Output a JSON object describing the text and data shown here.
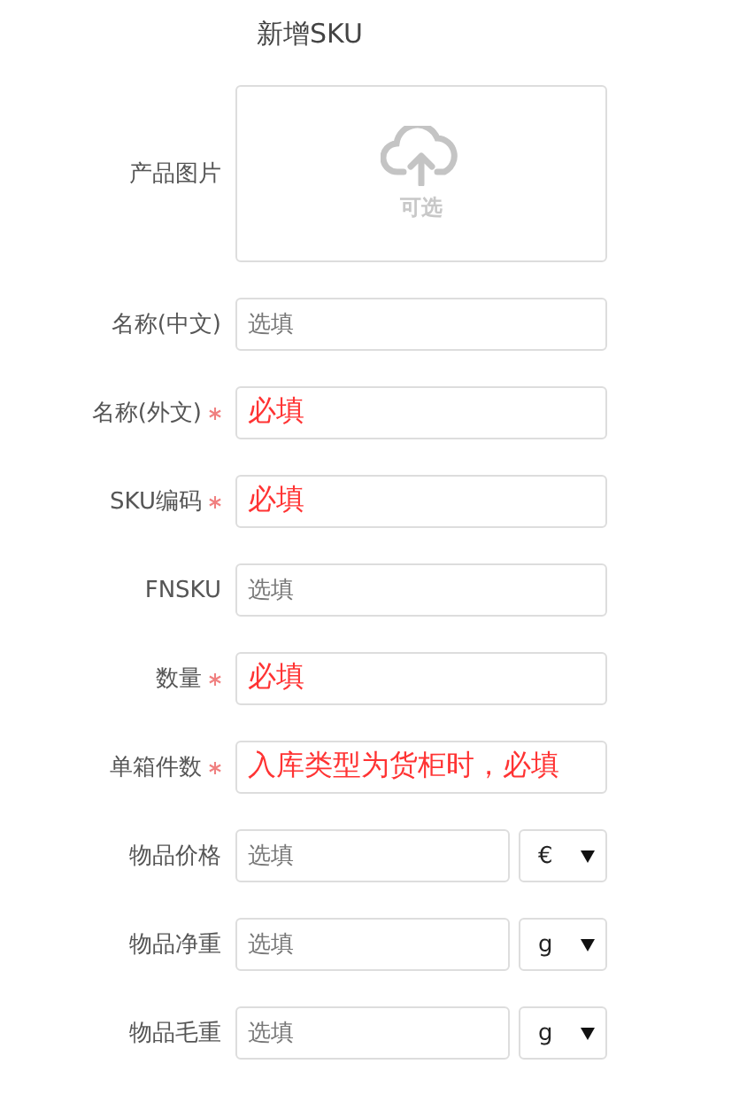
{
  "title": "新增SKU",
  "fields": [
    {
      "kind": "image",
      "label": "产品图片",
      "hint": "可选"
    },
    {
      "kind": "text",
      "label": "名称(中文)",
      "required": false,
      "placeholder": "选填"
    },
    {
      "kind": "text",
      "label": "名称(外文)",
      "required": true,
      "placeholder": "必填"
    },
    {
      "kind": "text",
      "label": "SKU编码",
      "required": true,
      "placeholder": "必填"
    },
    {
      "kind": "text",
      "label": "FNSKU",
      "required": false,
      "placeholder": "选填"
    },
    {
      "kind": "text",
      "label": "数量",
      "required": true,
      "placeholder": "必填"
    },
    {
      "kind": "text",
      "label": "单箱件数",
      "required": true,
      "placeholder": "入库类型为货柜时，必填"
    },
    {
      "kind": "text_unit",
      "label": "物品价格",
      "required": false,
      "placeholder": "选填",
      "unit": "€"
    },
    {
      "kind": "text_unit",
      "label": "物品净重",
      "required": false,
      "placeholder": "选填",
      "unit": "g"
    },
    {
      "kind": "text_unit",
      "label": "物品毛重",
      "required": false,
      "placeholder": "选填",
      "unit": "g"
    }
  ]
}
